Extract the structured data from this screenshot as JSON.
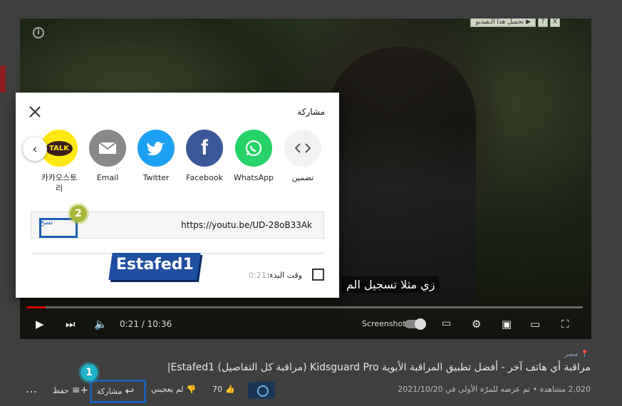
{
  "player": {
    "info_icon": "info-icon",
    "download_bar": {
      "label": "تحميل هذا الـفيديو ▶",
      "help": "?",
      "close": "X"
    },
    "caption": "زي مثلا تسجيل الم",
    "time": "0:21 / 10:36",
    "screenshot_label": "Screenshot",
    "progress_fraction": 0.0333
  },
  "share_dialog": {
    "title": "مشاركة",
    "options": [
      {
        "label": "تضمين",
        "icon": "embed-icon",
        "color": "#f2f2f2"
      },
      {
        "label": "WhatsApp",
        "icon": "whatsapp-icon",
        "color": "#25d366"
      },
      {
        "label": "Facebook",
        "icon": "facebook-icon",
        "color": "#3b5998"
      },
      {
        "label": "Twitter",
        "icon": "twitter-icon",
        "color": "#1da1f2"
      },
      {
        "label": "Email",
        "icon": "email-icon",
        "color": "#888888"
      },
      {
        "label": "카카오스토\n리",
        "icon": "kakaotalk-icon",
        "color": "#ffe812"
      }
    ],
    "kakao_badge_text": "TALK",
    "url": "https://youtu.be/UD-28oB33Ak",
    "copy_label": "نسخ",
    "start_at_label": "وقت البدء:",
    "start_at_time": "0:21"
  },
  "watermark": {
    "text": "Estafed1"
  },
  "annotations": {
    "badge1": "1",
    "badge2": "2"
  },
  "video_info": {
    "location": "مصر",
    "title": "مراقبة أي هاتف آخر - أفضل تطبيق المراقبة الأبوية Kidsguard Pro (مراقبة كل التفاصيل) Estafed1|",
    "meta": "2,020 مشاهدة • تم عرضه للمرّة الأولى في 2021/10/20",
    "likes": "70",
    "dislike_label": "لم يعجبني",
    "share_label": "مشاركة",
    "save_label": "حفظ",
    "more": "…"
  }
}
